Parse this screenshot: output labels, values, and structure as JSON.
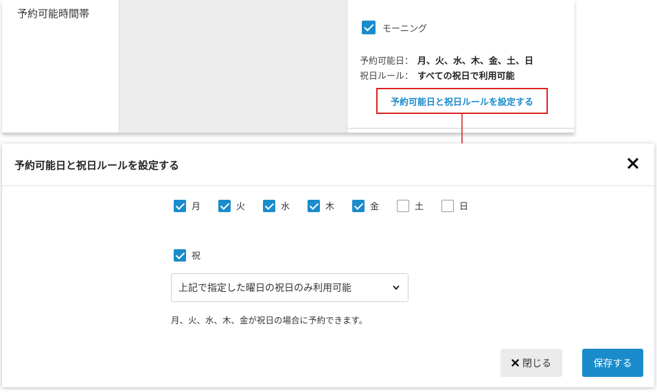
{
  "settings": {
    "row_label": "予約可能時間帯",
    "morning_label": "モーニング",
    "available_days_key": "予約可能日：",
    "available_days_value": "月、火、水、木、金、土、日",
    "holiday_rule_key": "祝日ルール：",
    "holiday_rule_value": "すべての祝日で利用可能",
    "set_link": "予約可能日と祝日ルールを設定する"
  },
  "modal": {
    "title": "予約可能日と祝日ルールを設定する",
    "days": [
      {
        "label": "月",
        "checked": true
      },
      {
        "label": "火",
        "checked": true
      },
      {
        "label": "水",
        "checked": true
      },
      {
        "label": "木",
        "checked": true
      },
      {
        "label": "金",
        "checked": true
      },
      {
        "label": "土",
        "checked": false
      },
      {
        "label": "日",
        "checked": false
      }
    ],
    "holiday_label": "祝",
    "holiday_checked": true,
    "holiday_select_value": "上記で指定した曜日の祝日のみ利用可能",
    "note": "月、火、水、木、金が祝日の場合に予約できます。",
    "close_button": "閉じる",
    "save_button": "保存する"
  },
  "colors": {
    "accent": "#1a8ccc",
    "highlight_border": "#e02020"
  }
}
